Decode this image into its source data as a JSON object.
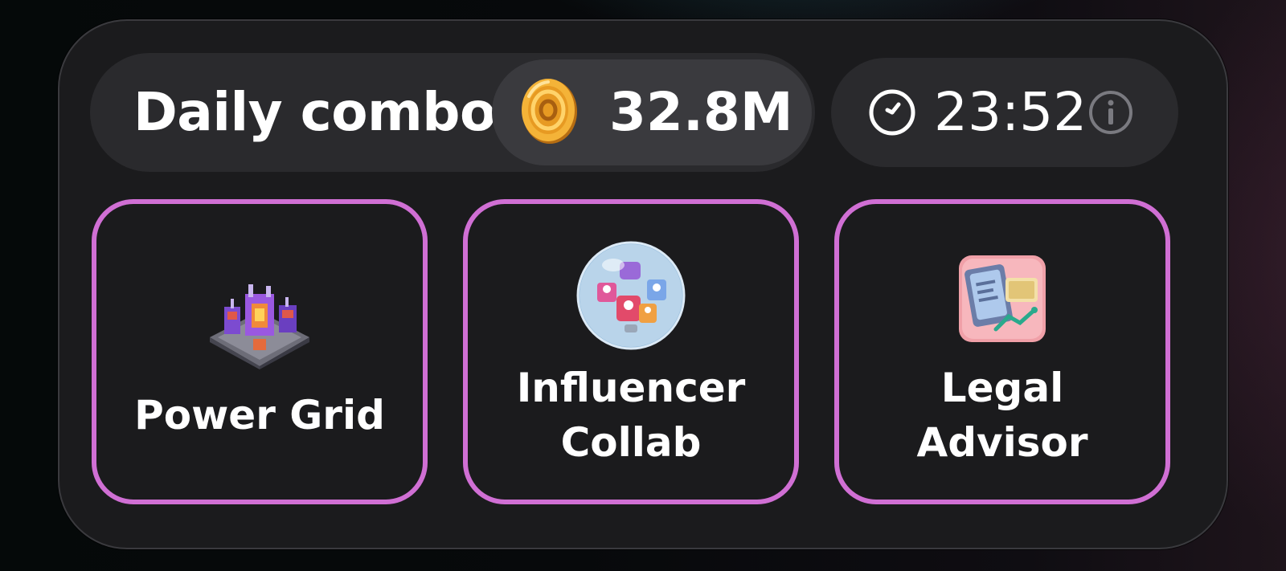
{
  "combo": {
    "label": "Daily combo",
    "reward": "32.8M",
    "reward_icon": "coin-icon"
  },
  "timer": {
    "value": "23:52",
    "clock_icon": "clock-icon",
    "info_icon": "info-icon"
  },
  "cards": [
    {
      "title_line1": "Power Grid",
      "title_line2": "",
      "icon": "power-grid-icon"
    },
    {
      "title_line1": "Influencer",
      "title_line2": "Collab",
      "icon": "influencer-collab-icon"
    },
    {
      "title_line1": "Legal",
      "title_line2": "Advisor",
      "icon": "legal-advisor-icon"
    }
  ],
  "colors": {
    "card_border": "#d06fd4",
    "panel_bg": "#1b1b1d",
    "pill_bg": "#2a2a2d",
    "coin": "#f5b83a"
  }
}
